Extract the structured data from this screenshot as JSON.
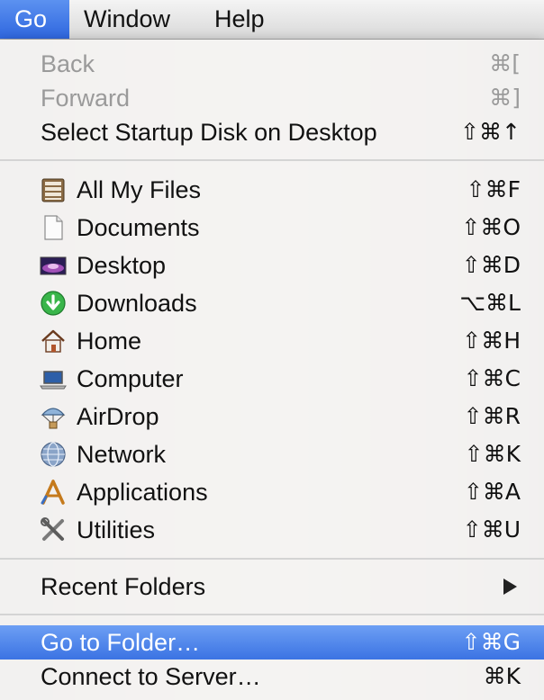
{
  "menubar": {
    "items": [
      {
        "label": "Go"
      },
      {
        "label": "Window"
      },
      {
        "label": "Help"
      }
    ]
  },
  "menu": {
    "group1": [
      {
        "label": "Back",
        "shortcut": "⌘[",
        "state": "disabled"
      },
      {
        "label": "Forward",
        "shortcut": "⌘]",
        "state": "disabled"
      },
      {
        "label": "Select Startup Disk on Desktop",
        "shortcut": "⇧⌘↑",
        "state": "enabled"
      }
    ],
    "places": [
      {
        "label": "All My Files",
        "shortcut": "⇧⌘F",
        "icon": "all-my-files-icon"
      },
      {
        "label": "Documents",
        "shortcut": "⇧⌘O",
        "icon": "documents-icon"
      },
      {
        "label": "Desktop",
        "shortcut": "⇧⌘D",
        "icon": "desktop-icon"
      },
      {
        "label": "Downloads",
        "shortcut": "⌥⌘L",
        "icon": "downloads-icon"
      },
      {
        "label": "Home",
        "shortcut": "⇧⌘H",
        "icon": "home-icon"
      },
      {
        "label": "Computer",
        "shortcut": "⇧⌘C",
        "icon": "computer-icon"
      },
      {
        "label": "AirDrop",
        "shortcut": "⇧⌘R",
        "icon": "airdrop-icon"
      },
      {
        "label": "Network",
        "shortcut": "⇧⌘K",
        "icon": "network-icon"
      },
      {
        "label": "Applications",
        "shortcut": "⇧⌘A",
        "icon": "applications-icon"
      },
      {
        "label": "Utilities",
        "shortcut": "⇧⌘U",
        "icon": "utilities-icon"
      }
    ],
    "recent_folders": {
      "label": "Recent Folders",
      "icon": "submenu-arrow-icon"
    },
    "go_to_folder": {
      "label": "Go to Folder…",
      "shortcut": "⇧⌘G",
      "state": "highlighted"
    },
    "connect_to_server": {
      "label": "Connect to Server…",
      "shortcut": "⌘K"
    }
  },
  "colors": {
    "highlight": "#3b73e3",
    "disabled_text": "#9a9a9a",
    "menu_background": "#f6f6f6"
  }
}
